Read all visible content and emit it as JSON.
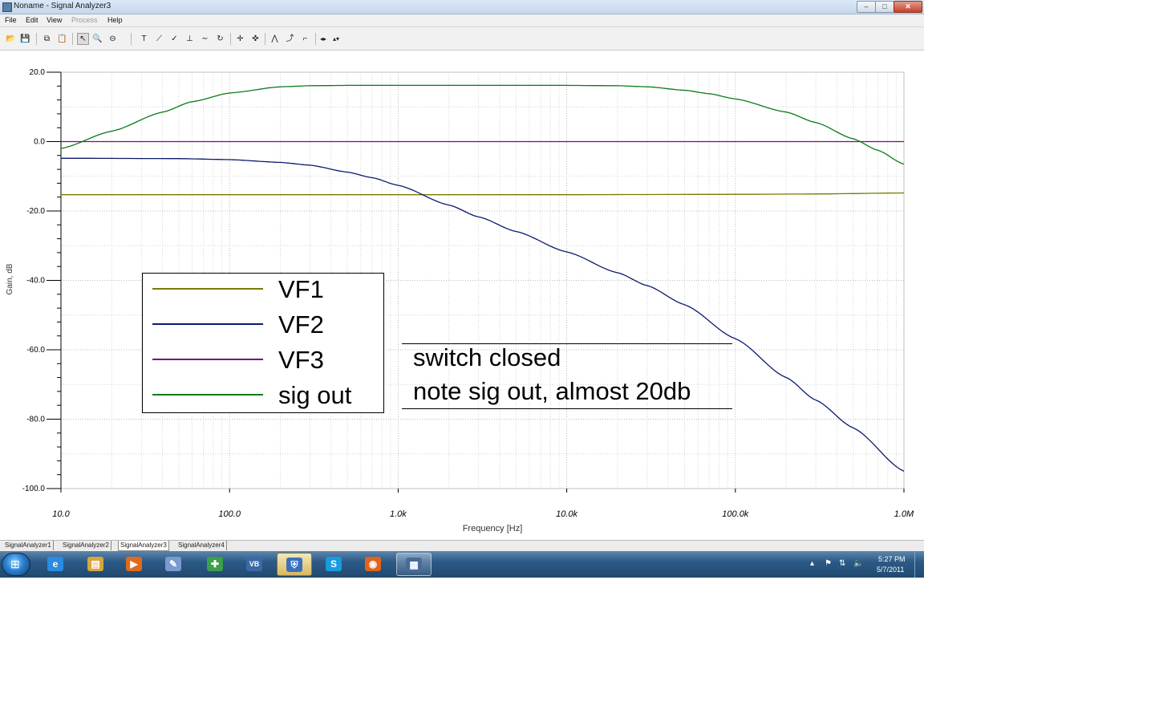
{
  "window": {
    "title": "Noname - Signal Analyzer3",
    "controls": {
      "minimize": "–",
      "maximize": "□",
      "close": "✕"
    }
  },
  "menu": [
    {
      "label": "File",
      "enabled": true
    },
    {
      "label": "Edit",
      "enabled": true
    },
    {
      "label": "View",
      "enabled": true
    },
    {
      "label": "Process",
      "enabled": false
    },
    {
      "label": "Help",
      "enabled": true
    }
  ],
  "toolbar": {
    "open_icon": "📂",
    "save_icon": "💾",
    "copy_icon": "⧉",
    "paste_icon": "📋",
    "pointer_icon": "↖",
    "zoom_icon": "🔍",
    "zoom_out_icon": "⊖",
    "text_icon": "T",
    "draw_line_icon": "⟋",
    "marker_icon": "✓",
    "axis_icon": "⊥",
    "curve_icon": "∼",
    "refresh_icon": "↻",
    "cursor_a_icon": "✛",
    "cursor_b_icon": "✜",
    "peak_icon": "⋀",
    "slope_icon": "⤴",
    "step_icon": "⌐",
    "arrow_lr_icon": "◂▸",
    "arrow_ud_icon": "▴▾"
  },
  "chart_data": {
    "type": "line",
    "xlabel": "Frequency [Hz]",
    "ylabel": "Gain, dB",
    "xscale": "log",
    "xlim": [
      10,
      1000000
    ],
    "ylim": [
      -100,
      20
    ],
    "grid": true,
    "xticks": [
      {
        "value": 10,
        "label": "10.0"
      },
      {
        "value": 100,
        "label": "100.0"
      },
      {
        "value": 1000,
        "label": "1.0k"
      },
      {
        "value": 10000,
        "label": "10.0k"
      },
      {
        "value": 100000,
        "label": "100.0k"
      },
      {
        "value": 1000000,
        "label": "1.0M"
      }
    ],
    "yticks": [
      {
        "value": 20,
        "label": "20.0"
      },
      {
        "value": 0,
        "label": "0.0"
      },
      {
        "value": -20,
        "label": "-20.0"
      },
      {
        "value": -40,
        "label": "-40.0"
      },
      {
        "value": -60,
        "label": "-60.0"
      },
      {
        "value": -80,
        "label": "-80.0"
      },
      {
        "value": -100,
        "label": "-100.0"
      }
    ],
    "legend_position": "lower-left",
    "series": [
      {
        "name": "VF1",
        "color": "#7a7a00",
        "x": [
          10,
          100,
          1000,
          10000,
          100000,
          300000,
          1000000
        ],
        "y": [
          -15.3,
          -15.3,
          -15.3,
          -15.3,
          -15.2,
          -15.1,
          -14.8
        ]
      },
      {
        "name": "VF2",
        "color": "#0a1a6e",
        "x": [
          10,
          50,
          100,
          200,
          300,
          500,
          700,
          1000,
          2000,
          3000,
          5000,
          10000,
          20000,
          30000,
          50000,
          100000,
          200000,
          300000,
          500000,
          1000000
        ],
        "y": [
          -4.8,
          -4.9,
          -5.2,
          -6,
          -6.8,
          -8.8,
          -10.4,
          -12.6,
          -18.3,
          -21.7,
          -25.9,
          -31.8,
          -37.8,
          -41.5,
          -47,
          -56.8,
          -68,
          -74.5,
          -82.5,
          -95
        ]
      },
      {
        "name": "VF3",
        "color": "#7a0a7a",
        "x": [
          10,
          100,
          1000,
          10000,
          100000,
          1000000
        ],
        "y": [
          0,
          0,
          0,
          0,
          0,
          0
        ]
      },
      {
        "name": "sig out",
        "color": "#0a7a1a",
        "x": [
          10,
          20,
          40,
          60,
          100,
          200,
          300,
          500,
          1000,
          3000,
          10000,
          20000,
          30000,
          50000,
          70000,
          100000,
          200000,
          300000,
          500000,
          700000,
          1000000
        ],
        "y": [
          -2,
          3,
          8.5,
          11.5,
          14,
          15.8,
          16.1,
          16.2,
          16.2,
          16.2,
          16.2,
          16.1,
          15.8,
          14.8,
          13.8,
          12.3,
          8.5,
          5.5,
          0.8,
          -2.5,
          -6.5
        ]
      }
    ]
  },
  "annotation": {
    "line1": "switch closed",
    "line2": "note sig out, almost 20db"
  },
  "sheet_tabs": [
    {
      "label": "SignalAnalyzer1",
      "active": false
    },
    {
      "label": "SignalAnalyzer2",
      "active": false
    },
    {
      "label": "SignalAnalyzer3",
      "active": true
    },
    {
      "label": "SignalAnalyzer4",
      "active": false
    }
  ],
  "taskbar": {
    "start_icon": "⊞",
    "apps": [
      {
        "name": "internet-explorer-icon",
        "glyph": "e",
        "color": "#2a8be0"
      },
      {
        "name": "file-explorer-icon",
        "glyph": "▤",
        "color": "#d9a63a"
      },
      {
        "name": "media-player-icon",
        "glyph": "▶",
        "color": "#e06a1a"
      },
      {
        "name": "paint-icon",
        "glyph": "✎",
        "color": "#7a9ad0"
      },
      {
        "name": "color-app-icon",
        "glyph": "✚",
        "color": "#3aa04a"
      },
      {
        "name": "vb-app-icon",
        "glyph": "VB",
        "color": "#3a6aa8"
      },
      {
        "name": "security-shield-icon",
        "glyph": "⛨",
        "color": "#3a70c0"
      },
      {
        "name": "skype-icon",
        "glyph": "S",
        "color": "#1a9ae0"
      },
      {
        "name": "firefox-icon",
        "glyph": "◉",
        "color": "#e0641a"
      },
      {
        "name": "signal-analyzer-app-icon",
        "glyph": "▦",
        "color": "#4a6a9a"
      }
    ],
    "tray": {
      "show_hidden": "▴",
      "flag_icon": "⚑",
      "network_icon": "⇅",
      "volume_icon": "🔈",
      "time": "5:27 PM",
      "date": "5/7/2011"
    }
  }
}
